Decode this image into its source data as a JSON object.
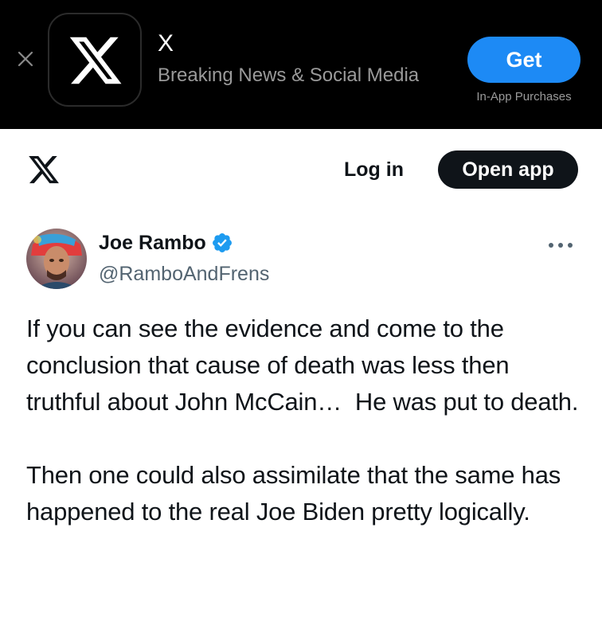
{
  "app_banner": {
    "close_icon": "close-icon",
    "app_icon": "x-logo-icon",
    "app_name": "X",
    "app_subtitle": "Breaking News & Social Media",
    "get_label": "Get",
    "in_app_purchases": "In-App Purchases",
    "accent_color": "#1d8af5"
  },
  "header": {
    "logo_icon": "x-logo-icon",
    "login_label": "Log in",
    "open_app_label": "Open app"
  },
  "tweet": {
    "author_name": "Joe Rambo",
    "verified_icon": "verified-badge-icon",
    "verified_color": "#1d9bf0",
    "handle": "@RamboAndFrens",
    "more_icon": "more-horizontal-icon",
    "text": "If you can see the evidence and come to the conclusion that cause of death was less then truthful about John McCain…  He was put to death.\n\nThen one could also assimilate that the same has happened to the real Joe Biden pretty logically."
  }
}
